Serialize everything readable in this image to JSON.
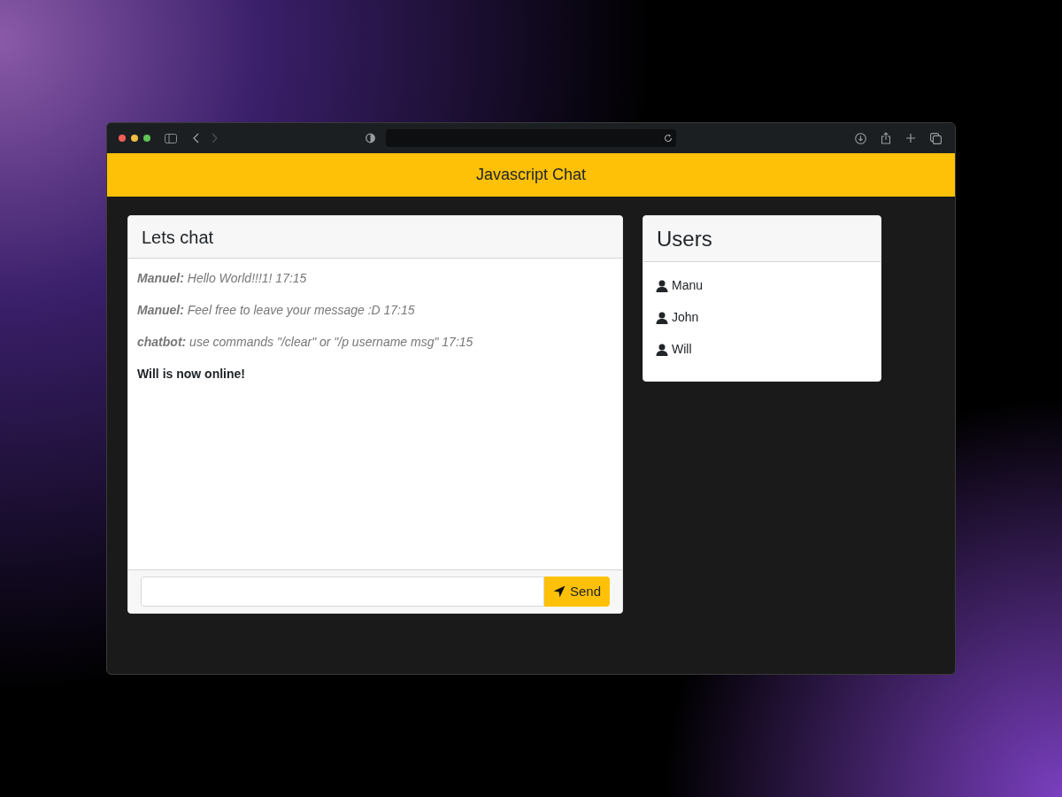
{
  "header": {
    "title": "Javascript Chat"
  },
  "chat": {
    "title": "Lets chat",
    "messages": [
      {
        "kind": "message",
        "text": "**Manuel:** Hello World!!!1! 17:15"
      },
      {
        "kind": "message",
        "text": "**Manuel:** Feel free to leave your message :D 17:15"
      },
      {
        "kind": "message",
        "text": "**chatbot:** use commands \"/clear\" or \"/p username msg\" 17:15"
      },
      {
        "kind": "notice",
        "text": "Will is now online!"
      }
    ],
    "send_label": "Send"
  },
  "users": {
    "title": "Users",
    "items": [
      {
        "name": "Manu"
      },
      {
        "name": "John"
      },
      {
        "name": "Will"
      }
    ]
  }
}
